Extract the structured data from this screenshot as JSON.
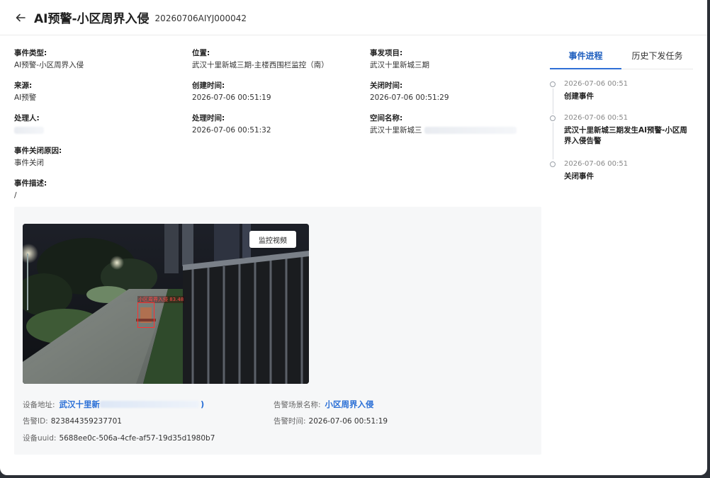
{
  "header": {
    "title": "AI预警-小区周界入侵",
    "code": "20260706AIYJ000042"
  },
  "fields": {
    "event_type": {
      "label": "事件类型:",
      "value": "AI预警-小区周界入侵"
    },
    "location": {
      "label": "位置:",
      "value": "武汉十里新城三期-主楼西围栏监控（南）"
    },
    "project": {
      "label": "事发项目:",
      "value": "武汉十里新城三期"
    },
    "source": {
      "label": "来源:",
      "value": "AI预警"
    },
    "created_time": {
      "label": "创建时间:",
      "value": "2026-07-06 00:51:19"
    },
    "closed_time": {
      "label": "关闭时间:",
      "value": "2026-07-06 00:51:29"
    },
    "handler": {
      "label": "处理人:",
      "value": ""
    },
    "handled_time": {
      "label": "处理时间:",
      "value": "2026-07-06 00:51:32"
    },
    "space_name": {
      "label": "空间名称:",
      "value": "武汉十里新城三"
    },
    "close_reason": {
      "label": "事件关闭原因:",
      "value": "事件关闭"
    },
    "description": {
      "label": "事件描述:",
      "value": "/"
    }
  },
  "alarm": {
    "video_button": "监控视频",
    "detection_label": "小区周界入侵 83.48",
    "device_address_label": "设备地址:",
    "device_address_value": "武汉十里新",
    "device_address_tail": ")",
    "scene_label": "告警场景名称:",
    "scene_value": "小区周界入侵",
    "alarm_id_label": "告警ID:",
    "alarm_id_value": "823844359237701",
    "alarm_time_label": "告警时间:",
    "alarm_time_value": "2026-07-06 00:51:19",
    "uuid_label": "设备uuid:",
    "uuid_value": "5688ee0c-506a-4cfe-af57-19d35d1980b7"
  },
  "tabs": [
    {
      "label": "事件进程",
      "active": true
    },
    {
      "label": "历史下发任务",
      "active": false
    }
  ],
  "timeline": [
    {
      "time": "2026-07-06 00:51",
      "text": "创建事件"
    },
    {
      "time": "2026-07-06 00:51",
      "text": "武汉十里新城三期发生AI预警-小区周界入侵告警"
    },
    {
      "time": "2026-07-06 00:51",
      "text": "关闭事件"
    }
  ],
  "colors": {
    "accent": "#2f6fd6",
    "link": "#2a6fd6",
    "detection": "#ff3030"
  },
  "icons": {
    "back": "arrow-left-icon"
  }
}
